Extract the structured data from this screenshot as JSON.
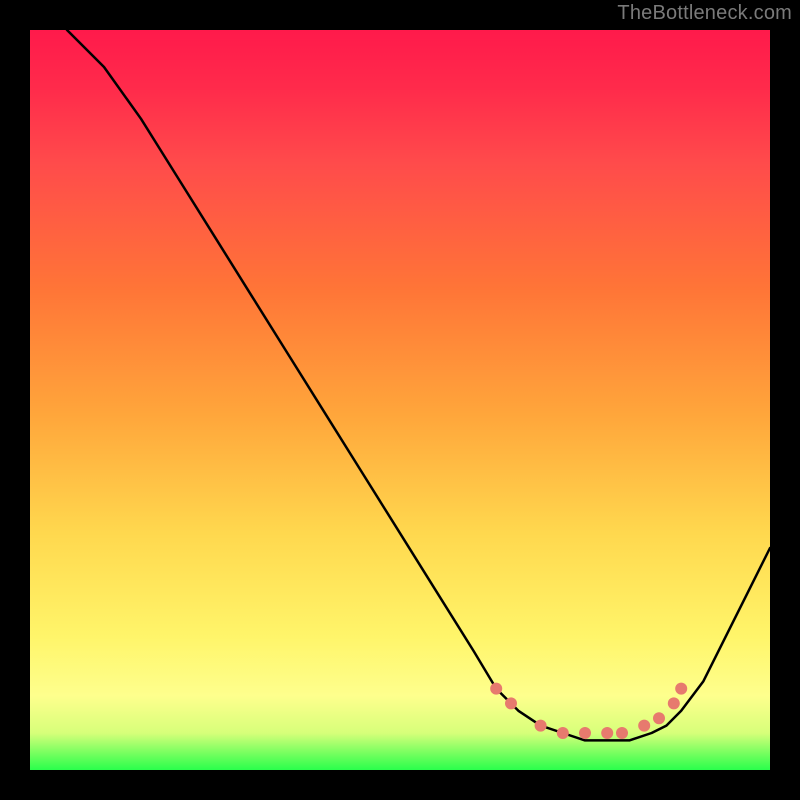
{
  "watermark": "TheBottleneck.com",
  "colors": {
    "page_bg": "#000000",
    "curve_stroke": "#000000",
    "dot_fill": "#e77a6e",
    "watermark_text": "#7a7a7a"
  },
  "chart_data": {
    "type": "line",
    "title": "",
    "xlabel": "",
    "ylabel": "",
    "xlim": [
      0,
      100
    ],
    "ylim": [
      0,
      100
    ],
    "series": [
      {
        "name": "bottleneck-curve",
        "x": [
          5,
          10,
          15,
          20,
          25,
          30,
          35,
          40,
          45,
          50,
          55,
          60,
          63,
          66,
          69,
          72,
          75,
          78,
          81,
          84,
          86,
          88,
          91,
          94,
          97,
          100
        ],
        "y": [
          100,
          95,
          88,
          80,
          72,
          64,
          56,
          48,
          40,
          32,
          24,
          16,
          11,
          8,
          6,
          5,
          4,
          4,
          4,
          5,
          6,
          8,
          12,
          18,
          24,
          30
        ]
      }
    ],
    "highlight_dots": {
      "name": "optimal-range-dots",
      "points": [
        {
          "x": 63,
          "y": 11
        },
        {
          "x": 65,
          "y": 9
        },
        {
          "x": 69,
          "y": 6
        },
        {
          "x": 72,
          "y": 5
        },
        {
          "x": 75,
          "y": 5
        },
        {
          "x": 78,
          "y": 5
        },
        {
          "x": 80,
          "y": 5
        },
        {
          "x": 83,
          "y": 6
        },
        {
          "x": 85,
          "y": 7
        },
        {
          "x": 87,
          "y": 9
        },
        {
          "x": 88,
          "y": 11
        }
      ]
    },
    "gradient_stops": [
      {
        "pos": 0.0,
        "color": "#ff1a4b"
      },
      {
        "pos": 0.08,
        "color": "#ff2b4b"
      },
      {
        "pos": 0.18,
        "color": "#ff4b4b"
      },
      {
        "pos": 0.35,
        "color": "#ff7537"
      },
      {
        "pos": 0.52,
        "color": "#ffa63b"
      },
      {
        "pos": 0.68,
        "color": "#ffd84e"
      },
      {
        "pos": 0.82,
        "color": "#fff56a"
      },
      {
        "pos": 0.9,
        "color": "#feff8d"
      },
      {
        "pos": 0.95,
        "color": "#d7ff7a"
      },
      {
        "pos": 0.98,
        "color": "#6dff5d"
      },
      {
        "pos": 1.0,
        "color": "#2aff4c"
      }
    ]
  }
}
